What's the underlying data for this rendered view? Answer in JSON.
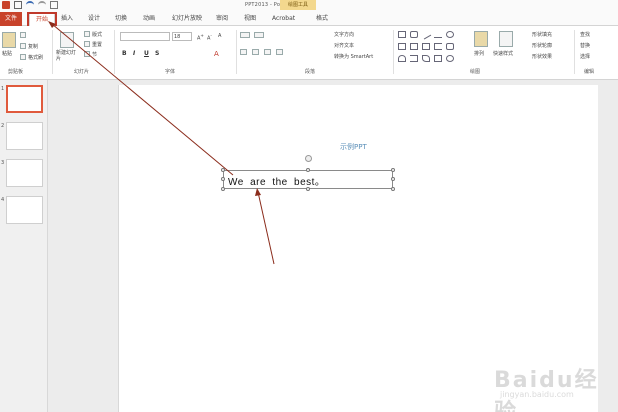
{
  "window": {
    "title": "PPT2013 - PowerPoint",
    "context_label": "绘图工具"
  },
  "tabs": {
    "file": "文件",
    "items": [
      "开始",
      "插入",
      "设计",
      "切换",
      "动画",
      "幻灯片放映",
      "审阅",
      "视图",
      "Acrobat",
      "格式"
    ],
    "active": "开始"
  },
  "ribbon": {
    "clipboard": {
      "paste": "粘贴",
      "copy": "复制",
      "format_painter": "格式刷",
      "label": "剪贴板"
    },
    "slides": {
      "new_slide": "新建幻灯片",
      "layout": "版式",
      "reset": "重置",
      "section": "节",
      "label": "幻灯片"
    },
    "font": {
      "size": "18",
      "bold": "B",
      "italic": "I",
      "underline": "U",
      "strike": "S",
      "label": "字体"
    },
    "paragraph": {
      "text_direction": "文字方向",
      "align_text": "对齐文本",
      "convert_smartart": "转换为 SmartArt",
      "label": "段落"
    },
    "drawing": {
      "arrange": "排列",
      "quick_styles": "快速样式",
      "shape_fill": "形状填充",
      "shape_outline": "形状轮廓",
      "shape_effects": "形状效果",
      "label": "绘图"
    },
    "editing": {
      "find": "查找",
      "replace": "替换",
      "select": "选择",
      "label": "编辑"
    }
  },
  "thumbnails": [
    "1",
    "2",
    "3",
    "4"
  ],
  "slide": {
    "subtitle": "示例PPT",
    "textbox_text": "We are the best。"
  },
  "watermark": {
    "brand": "Baidu经验",
    "url": "jingyan.baidu.com"
  },
  "colors": {
    "file_tab": "#c8432b",
    "highlight": "#c0392b",
    "arrow": "#8b2c1c",
    "subtitle": "#5b8fb8"
  }
}
